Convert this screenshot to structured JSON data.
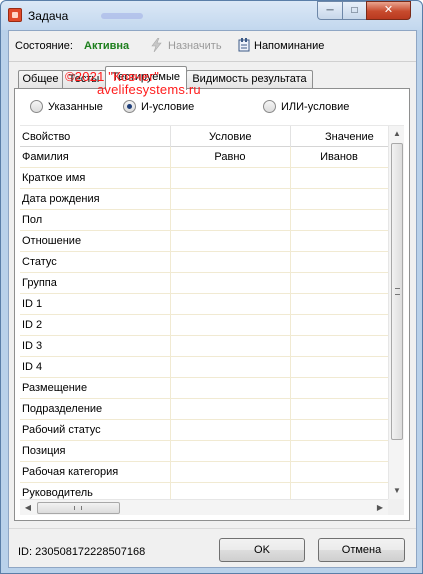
{
  "window": {
    "title": "Задача"
  },
  "status": {
    "label": "Состояние:",
    "value": "Активна",
    "assign_label": "Назначить",
    "reminder_label": "Напоминание"
  },
  "tabs": [
    {
      "label": "Общее"
    },
    {
      "label": "Тесты"
    },
    {
      "label": "Тестируемые"
    },
    {
      "label": "Видимость результата"
    }
  ],
  "watermark": {
    "line1": "©2021 \"Ковчег\"",
    "line2": "avelifesystems.ru"
  },
  "filter": {
    "options": [
      "Указанные",
      "И-условие",
      "ИЛИ-условие"
    ],
    "selected": "И-условие"
  },
  "grid": {
    "columns": [
      "Свойство",
      "Условие",
      "Значение"
    ],
    "rows": [
      [
        "Фамилия",
        "Равно",
        "Иванов"
      ],
      [
        "Краткое имя",
        "",
        ""
      ],
      [
        "Дата рождения",
        "",
        ""
      ],
      [
        "Пол",
        "",
        ""
      ],
      [
        "Отношение",
        "",
        ""
      ],
      [
        "Статус",
        "",
        ""
      ],
      [
        "Группа",
        "",
        ""
      ],
      [
        "ID 1",
        "",
        ""
      ],
      [
        "ID 2",
        "",
        ""
      ],
      [
        "ID 3",
        "",
        ""
      ],
      [
        "ID 4",
        "",
        ""
      ],
      [
        "Размещение",
        "",
        ""
      ],
      [
        "Подразделение",
        "",
        ""
      ],
      [
        "Рабочий статус",
        "",
        ""
      ],
      [
        "Позиция",
        "",
        ""
      ],
      [
        "Рабочая категория",
        "",
        ""
      ],
      [
        "Руководитель",
        "",
        ""
      ]
    ]
  },
  "footer": {
    "id_text": "ID: 230508172228507168",
    "ok_label": "OK",
    "cancel_label": "Отмена"
  },
  "colors": {
    "status_active": "#1d7f1d",
    "watermark": "#ff1c1c",
    "title_close": "#c74a2d"
  }
}
